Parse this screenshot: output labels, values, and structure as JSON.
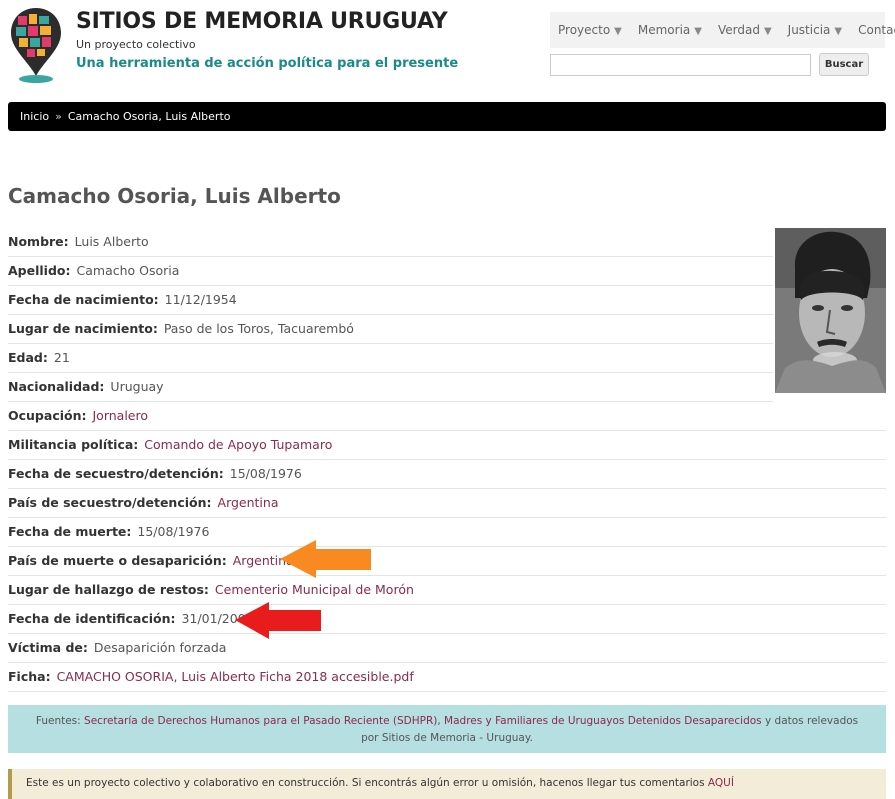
{
  "header": {
    "title": "SITIOS DE MEMORIA URUGUAY",
    "slogan": "Un proyecto colectivo",
    "tagline": "Una herramienta de acción política para el presente"
  },
  "nav": {
    "items": [
      {
        "label": "Proyecto",
        "dropdown": true
      },
      {
        "label": "Memoria",
        "dropdown": true
      },
      {
        "label": "Verdad",
        "dropdown": true
      },
      {
        "label": "Justicia",
        "dropdown": true
      },
      {
        "label": "Contacto",
        "dropdown": false
      }
    ]
  },
  "search": {
    "placeholder": "",
    "value": "",
    "button_label": "Buscar"
  },
  "breadcrumb": {
    "home": "Inicio",
    "separator": "»",
    "current": "Camacho Osoria, Luis Alberto"
  },
  "page": {
    "title": "Camacho Osoria, Luis Alberto"
  },
  "fields": [
    {
      "label": "Nombre:",
      "value": "Luis Alberto",
      "link": false
    },
    {
      "label": "Apellido:",
      "value": "Camacho Osoria",
      "link": false
    },
    {
      "label": "Fecha de nacimiento:",
      "value": "11/12/1954",
      "link": false
    },
    {
      "label": "Lugar de nacimiento:",
      "value": "Paso de los Toros, Tacuarembó",
      "link": false
    },
    {
      "label": "Edad:",
      "value": "21",
      "link": false
    },
    {
      "label": "Nacionalidad:",
      "value": "Uruguay",
      "link": false
    },
    {
      "label": "Ocupación:",
      "value": "Jornalero",
      "link": true
    },
    {
      "label": "Militancia política:",
      "value": "Comando de Apoyo Tupamaro",
      "link": true
    },
    {
      "label": "Fecha de secuestro/detención:",
      "value": "15/08/1976",
      "link": false
    },
    {
      "label": "País de secuestro/detención:",
      "value": "Argentina",
      "link": true
    },
    {
      "label": "Fecha de muerte:",
      "value": "15/08/1976",
      "link": false
    },
    {
      "label": "País de muerte o desaparición:",
      "value": "Argentina",
      "link": true
    },
    {
      "label": "Lugar de hallazgo de restos:",
      "value": "Cementerio Municipal de Morón",
      "link": true
    },
    {
      "label": "Fecha de identificación:",
      "value": "31/01/2002",
      "link": false
    },
    {
      "label": "Víctima de:",
      "value": "Desaparición forzada",
      "link": false
    },
    {
      "label": "Ficha:",
      "value": "CAMACHO OSORIA, Luis Alberto Ficha 2018 accesible.pdf",
      "link": true
    }
  ],
  "annotations": {
    "orange_arrow_color": "#f98a22",
    "red_arrow_color": "#e81c1c"
  },
  "sources": {
    "prefix": "Fuentes: ",
    "link1": "Secretaría de Derechos Humanos para el Pasado Reciente (SDHPR)",
    "sep": ", ",
    "link2": "Madres y Familiares de Uruguayos Detenidos Desaparecidos",
    "suffix": " y datos relevados por Sitios de Memoria - Uruguay."
  },
  "notice": {
    "text": "Este es un proyecto colectivo y colaborativo en construcción. Si encontrás algún error u omisión, hacenos llegar tus comentarios ",
    "link": "AQUÍ"
  },
  "colors": {
    "link": "#8a2a4c",
    "tagline": "#1a8a8a",
    "sources_bg": "#b5dfe0"
  }
}
